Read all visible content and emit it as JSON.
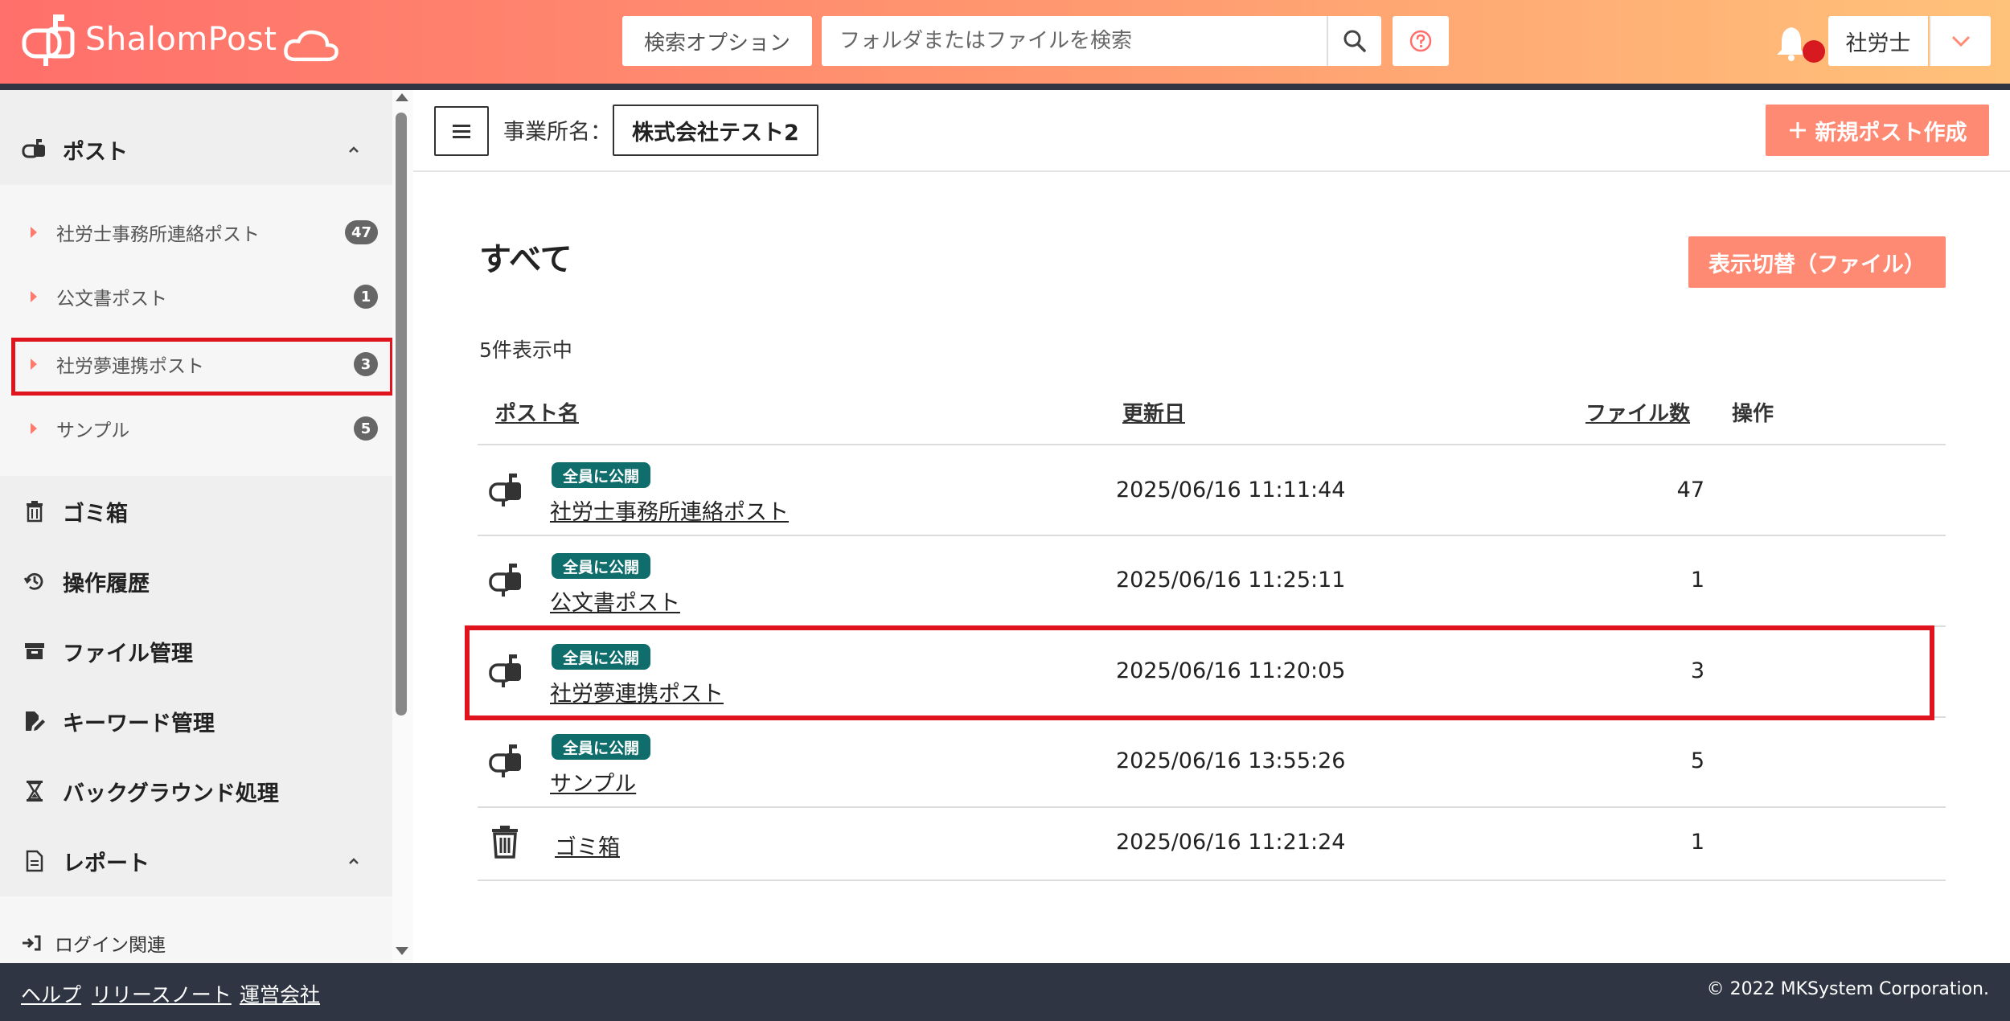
{
  "header": {
    "logo_text": "ShalomPost",
    "search_option_label": "検索オプション",
    "search_placeholder": "フォルダまたはファイルを検索",
    "user_label": "社労士"
  },
  "sidebar": {
    "post_section": "ポスト",
    "post_items": [
      {
        "label": "社労士事務所連絡ポスト",
        "count": "47"
      },
      {
        "label": "公文書ポスト",
        "count": "1"
      },
      {
        "label": "社労夢連携ポスト",
        "count": "3"
      },
      {
        "label": "サンプル",
        "count": "5"
      }
    ],
    "trash": "ゴミ箱",
    "history": "操作履歴",
    "file_manage": "ファイル管理",
    "keyword_manage": "キーワード管理",
    "background": "バックグラウンド処理",
    "report_section": "レポート",
    "report_items": [
      {
        "label": "ログイン関連"
      }
    ]
  },
  "toolbar": {
    "office_label": "事業所名：",
    "office_name": "株式会社テスト2",
    "new_post_label": "新規ポスト作成"
  },
  "main": {
    "title": "すべて",
    "toggle_label": "表示切替（ファイル）",
    "count_text": "5件表示中",
    "columns": {
      "name": "ポスト名",
      "updated": "更新日",
      "files": "ファイル数",
      "actions": "操作"
    },
    "rows": [
      {
        "badge": "全員に公開",
        "name": "社労士事務所連絡ポスト",
        "date": "2025/06/16 11:11:44",
        "files": "47",
        "icon": "mailbox-icon"
      },
      {
        "badge": "全員に公開",
        "name": "公文書ポスト",
        "date": "2025/06/16 11:25:11",
        "files": "1",
        "icon": "mailbox-icon"
      },
      {
        "badge": "全員に公開",
        "name": "社労夢連携ポスト",
        "date": "2025/06/16 11:20:05",
        "files": "3",
        "icon": "mailbox-icon"
      },
      {
        "badge": "全員に公開",
        "name": "サンプル",
        "date": "2025/06/16 13:55:26",
        "files": "5",
        "icon": "mailbox-icon"
      },
      {
        "badge": "",
        "name": "ゴミ箱",
        "date": "2025/06/16 11:21:24",
        "files": "1",
        "icon": "trash-icon"
      }
    ]
  },
  "footer": {
    "help": "ヘルプ",
    "release_notes": "リリースノート",
    "company": "運営会社",
    "copyright": "© 2022 MKSystem Corporation."
  },
  "colors": {
    "header_start": "#ff6f6b",
    "header_end": "#ffc27a",
    "accent": "#ff8a73",
    "badge_public": "#0f6d6b",
    "highlight": "#e0141f",
    "footer_bg": "#2f3542"
  }
}
